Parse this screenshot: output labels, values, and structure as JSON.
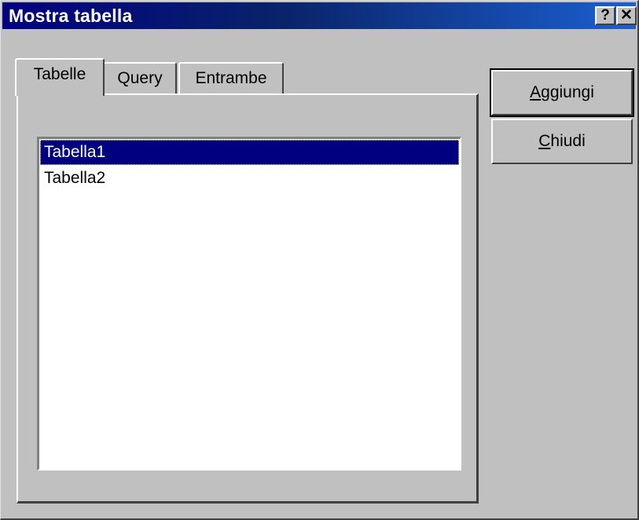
{
  "window": {
    "title": "Mostra tabella",
    "help_button": "?",
    "close_button": "✕"
  },
  "tabs": [
    {
      "label": "Tabelle",
      "active": true
    },
    {
      "label": "Query",
      "active": false
    },
    {
      "label": "Entrambe",
      "active": false
    }
  ],
  "list": {
    "items": [
      {
        "label": "Tabella1",
        "selected": true
      },
      {
        "label": "Tabella2",
        "selected": false
      }
    ]
  },
  "buttons": {
    "add": {
      "label": "Aggiungi",
      "mnemonic_first": "A",
      "rest": "ggiungi"
    },
    "close": {
      "label": "Chiudi",
      "mnemonic_first": "C",
      "rest": "hiudi"
    }
  },
  "colors": {
    "face": "#c0c0c0",
    "titlebar": "#000080",
    "selection": "#000080"
  }
}
